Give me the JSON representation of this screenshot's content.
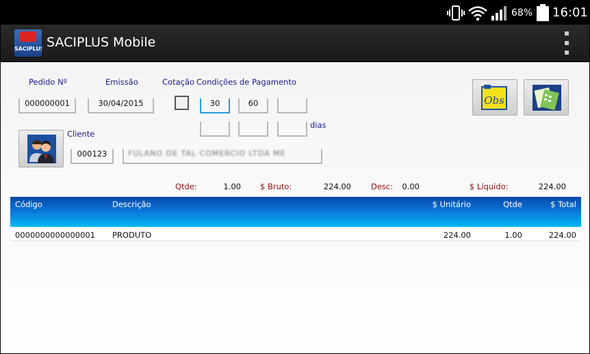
{
  "status_bar": {
    "battery_percent": "68%",
    "time": "16:01",
    "icons": [
      "vibrate-icon",
      "wifi-icon",
      "signal-icon",
      "battery-icon"
    ]
  },
  "action_bar": {
    "title": "SACIPLUS Mobile",
    "logo_text": "SACIPLUS",
    "menu_icon": "overflow-menu-icon"
  },
  "form": {
    "pedido_label": "Pedido Nº",
    "pedido_value": "000000001",
    "emissao_label": "Emissão",
    "emissao_value": "30/04/2015",
    "cotacao_label": "Cotação",
    "cotacao_checked": false,
    "condicoes_label": "Condições de Pagamento",
    "condicoes_values": [
      "30",
      "60",
      "",
      "",
      "",
      ""
    ],
    "dias_label": "dias",
    "cliente_label": "Cliente",
    "cliente_code": "000123",
    "cliente_name": "FULANO DE TAL COMERCIO LTDA ME"
  },
  "buttons": {
    "obs_icon": "obs-notes-icon",
    "obs_text": "Obs",
    "calc_icon": "calculator-icon",
    "cliente_icon": "client-users-icon"
  },
  "totals": {
    "qtde_label": "Qtde:",
    "qtde_value": "1.00",
    "bruto_label": "$ Bruto:",
    "bruto_value": "224.00",
    "desc_label": "Desc:",
    "desc_value": "0.00",
    "liquido_label": "$ Líquido:",
    "liquido_value": "224.00"
  },
  "table": {
    "headers": {
      "codigo": "Código",
      "descricao": "Descrição",
      "unitario": "$ Unitário",
      "qtde": "Qtde",
      "total": "$ Total"
    },
    "rows": [
      {
        "codigo": "0000000000000001",
        "descricao": "PRODUTO",
        "unitario": "224.00",
        "qtde": "1.00",
        "total": "224.00"
      }
    ]
  },
  "colors": {
    "label_blue": "#1a1a8c",
    "total_label_red": "#8b1010",
    "header_gradient_top": "#0849a8",
    "header_gradient_bottom": "#08b8f2"
  }
}
